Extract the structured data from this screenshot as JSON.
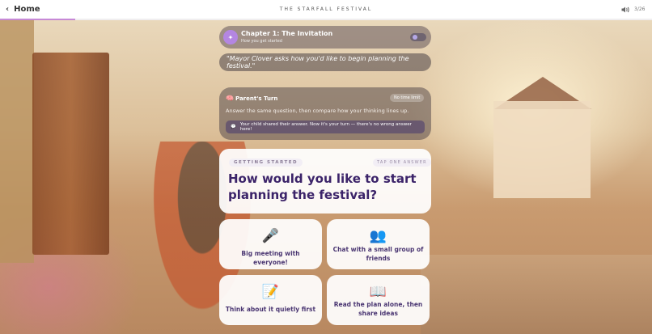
{
  "header": {
    "home_label": "Home",
    "app_title": "THE STARFALL FESTIVAL",
    "counter": "3/26",
    "progress_fraction": 0.115
  },
  "chapter": {
    "title": "Chapter 1: The Invitation",
    "subtitle": "How you get started"
  },
  "quote": "\"Mayor Clover asks how you'd like to begin planning the festival.\"",
  "parent_turn": {
    "icon": "brain-icon",
    "title": "Parent's Turn",
    "pill": "No time limit",
    "instruction": "Answer the same question, then compare how your thinking lines up.",
    "hint_icon": "speech-bubble-icon",
    "hint": "Your child shared their answer. Now it's your turn — there's no wrong answer here!"
  },
  "question": {
    "tag": "GETTING STARTED",
    "tag_right": "TAP ONE ANSWER",
    "text": "How would you like to start planning the festival?"
  },
  "options": [
    {
      "emoji": "🎤",
      "icon": "microphone-icon",
      "label": "Big meeting with everyone!"
    },
    {
      "emoji": "👥",
      "icon": "people-icon",
      "label": "Chat with a small group of friends"
    },
    {
      "emoji": "📝",
      "icon": "memo-icon",
      "label": "Think about it quietly first"
    },
    {
      "emoji": "📖",
      "icon": "book-icon",
      "label": "Read the plan alone, then share ideas"
    }
  ]
}
